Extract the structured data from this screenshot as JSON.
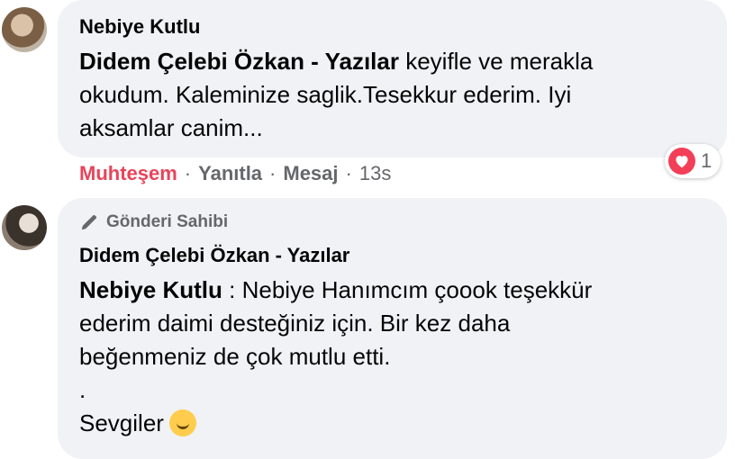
{
  "comment1": {
    "author": "Nebiye Kutlu",
    "mention": "Didem Çelebi Özkan - Yazılar",
    "text_line1": " keyifle ve merakla",
    "text_line2": "okudum. Kaleminize saglik.Tesekkur ederim. Iyi",
    "text_line3": "aksamlar canim...",
    "actions": {
      "reaction_label": "Muhteşem",
      "reply_label": "Yanıtla",
      "message_label": "Mesaj",
      "time": "13s",
      "separator": "·"
    },
    "reactions": {
      "icon": "heart-icon",
      "count": "1",
      "color": "#f33e58"
    }
  },
  "comment2": {
    "badge_label": "Gönderi Sahibi",
    "badge_icon": "pencil-icon",
    "author": "Didem Çelebi Özkan - Yazılar",
    "mention": "Nebiye Kutlu",
    "text_line1": " : Nebiye Hanımcım çoook teşekkür",
    "text_line2": "ederim daimi desteğiniz için. Bir kez daha",
    "text_line3": "beğenmeniz de çok mutlu etti.",
    "text_line4": ".",
    "text_line5": "Sevgiler",
    "emoji": "hugging-face-icon"
  },
  "colors": {
    "bubble": "#f0f2f5",
    "muted": "#65676b",
    "reaction_accent": "#e8445a"
  }
}
